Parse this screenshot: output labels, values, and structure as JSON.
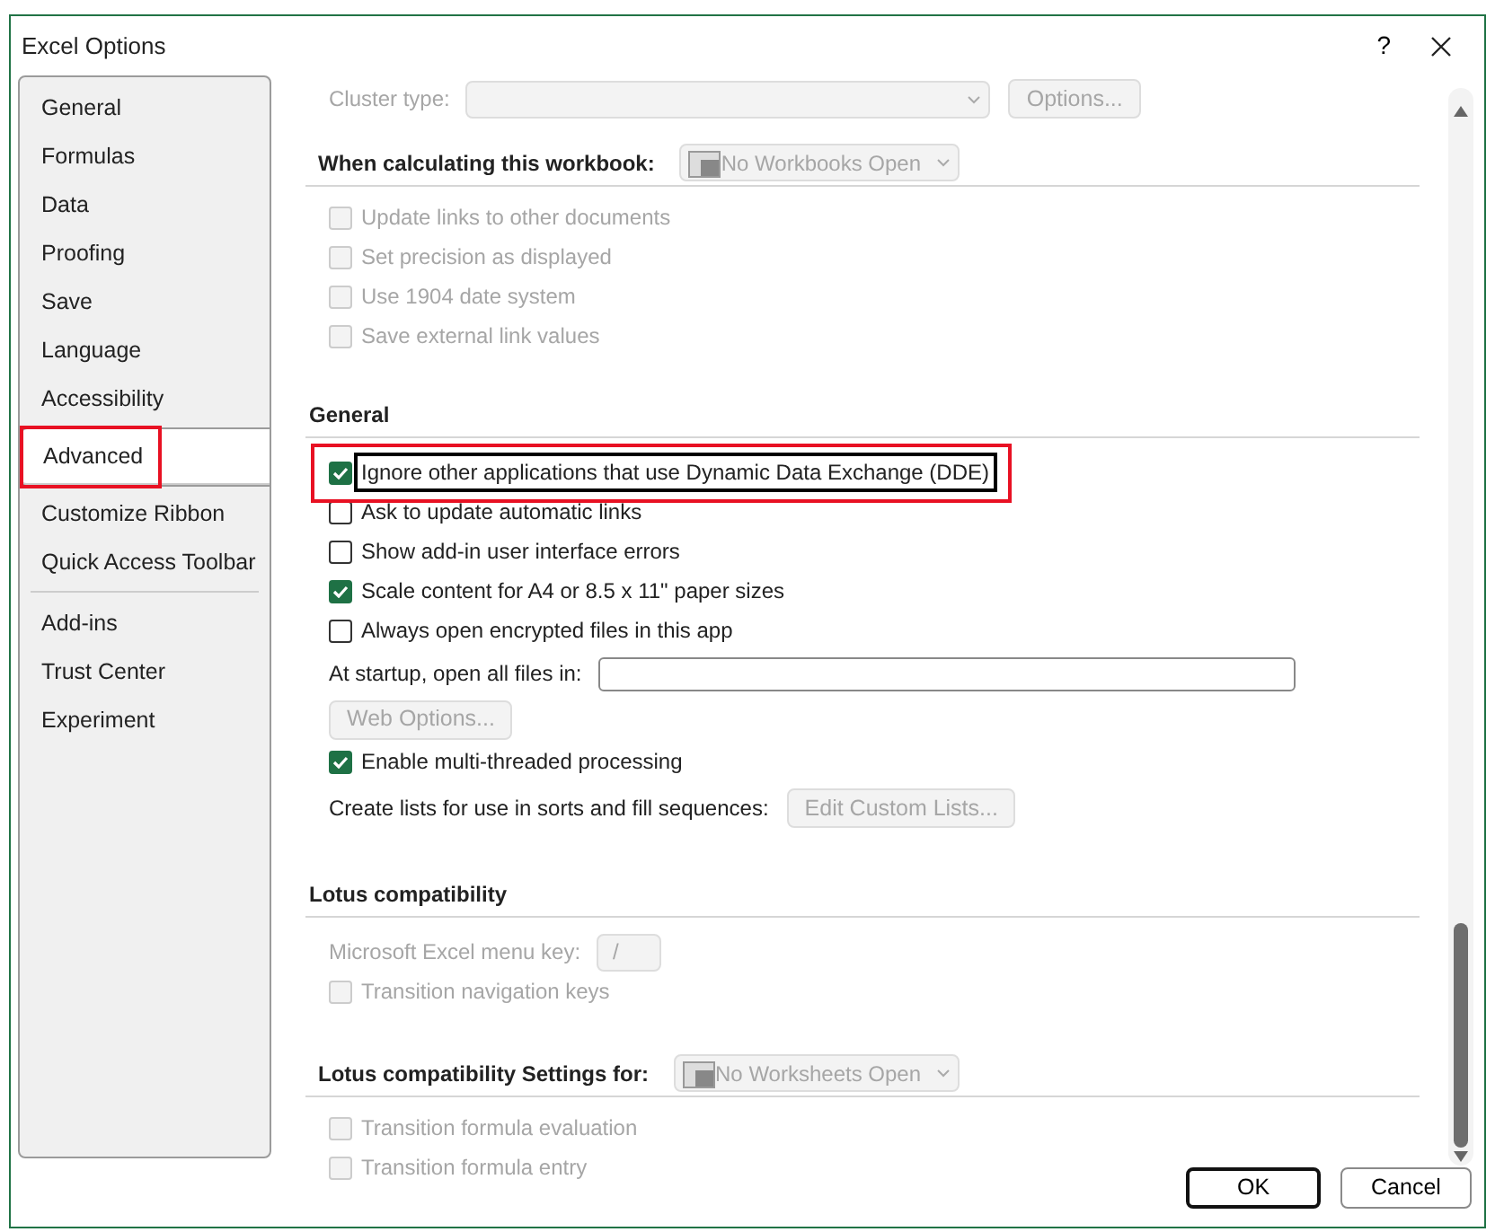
{
  "window": {
    "title": "Excel Options",
    "help": "?"
  },
  "sidebar": {
    "groups": [
      [
        {
          "label": "General",
          "selected": false,
          "highlighted": false
        },
        {
          "label": "Formulas",
          "selected": false,
          "highlighted": false
        },
        {
          "label": "Data",
          "selected": false,
          "highlighted": false
        },
        {
          "label": "Proofing",
          "selected": false,
          "highlighted": false
        },
        {
          "label": "Save",
          "selected": false,
          "highlighted": false
        },
        {
          "label": "Language",
          "selected": false,
          "highlighted": false
        },
        {
          "label": "Accessibility",
          "selected": false,
          "highlighted": false
        },
        {
          "label": "Advanced",
          "selected": true,
          "highlighted": true
        },
        {
          "label": "Customize Ribbon",
          "selected": false,
          "highlighted": false
        },
        {
          "label": "Quick Access Toolbar",
          "selected": false,
          "highlighted": false
        }
      ],
      [
        {
          "label": "Add-ins",
          "selected": false,
          "highlighted": false
        },
        {
          "label": "Trust Center",
          "selected": false,
          "highlighted": false
        },
        {
          "label": "Experiment",
          "selected": false,
          "highlighted": false
        }
      ]
    ]
  },
  "content": [
    {
      "kind": "combo",
      "label": "Cluster type:",
      "button": "Options...",
      "disabled": true
    },
    {
      "kind": "section-select",
      "label": "When calculating this workbook:",
      "value": "No Workbooks Open",
      "disabled": true
    },
    {
      "kind": "checkbox",
      "label": "Update links to other documents",
      "checked": false,
      "disabled": true
    },
    {
      "kind": "checkbox",
      "label": "Set precision as displayed",
      "checked": false,
      "disabled": true
    },
    {
      "kind": "checkbox",
      "label": "Use 1904 date system",
      "checked": false,
      "disabled": true
    },
    {
      "kind": "checkbox",
      "label": "Save external link values",
      "checked": false,
      "disabled": true
    },
    {
      "kind": "heading",
      "label": "General"
    },
    {
      "kind": "checkbox",
      "label": "Ignore other applications that use Dynamic Data Exchange (DDE)",
      "checked": true,
      "disabled": false,
      "focused": true,
      "highlighted": true
    },
    {
      "kind": "checkbox",
      "label": "Ask to update automatic links",
      "checked": false,
      "disabled": false
    },
    {
      "kind": "checkbox",
      "label": "Show add-in user interface errors",
      "checked": false,
      "disabled": false
    },
    {
      "kind": "checkbox",
      "label": "Scale content for A4 or 8.5 x 11\" paper sizes",
      "checked": true,
      "disabled": false
    },
    {
      "kind": "checkbox",
      "label": "Always open encrypted files in this app",
      "checked": false,
      "disabled": false
    },
    {
      "kind": "field",
      "label": "At startup, open all files in:",
      "disabled": false
    },
    {
      "kind": "button",
      "label": "Web Options...",
      "disabled": true
    },
    {
      "kind": "checkbox",
      "label": "Enable multi-threaded processing",
      "checked": true,
      "disabled": false
    },
    {
      "kind": "label-button",
      "label": "Create lists for use in sorts and fill sequences:",
      "button": "Edit Custom Lists...",
      "disabled": true
    },
    {
      "kind": "heading",
      "label": "Lotus compatibility"
    },
    {
      "kind": "key-field",
      "label": "Microsoft Excel menu key:",
      "value": "/",
      "disabled": true
    },
    {
      "kind": "checkbox",
      "label": "Transition navigation keys",
      "checked": false,
      "disabled": true
    },
    {
      "kind": "section-select",
      "label": "Lotus compatibility Settings for:",
      "value": "No Worksheets Open",
      "disabled": true
    },
    {
      "kind": "checkbox",
      "label": "Transition formula evaluation",
      "checked": false,
      "disabled": true
    },
    {
      "kind": "checkbox",
      "label": "Transition formula entry",
      "checked": false,
      "disabled": true
    }
  ],
  "buttons": [
    {
      "label": "OK",
      "default": true
    },
    {
      "label": "Cancel",
      "default": false
    }
  ]
}
